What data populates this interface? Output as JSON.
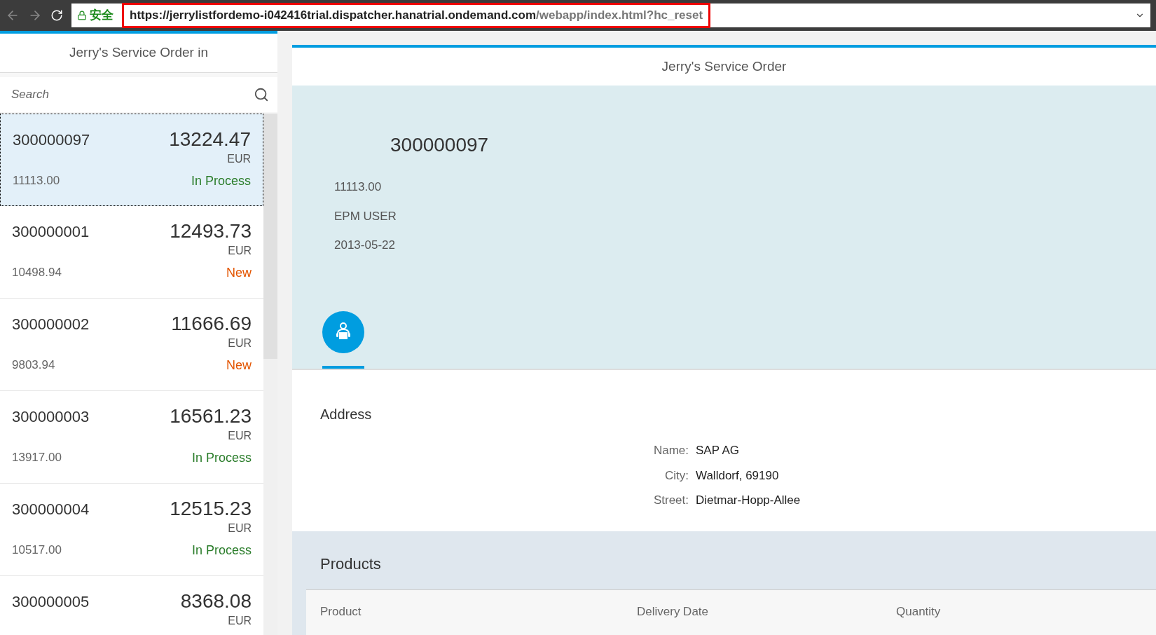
{
  "browser": {
    "security_label": "安全",
    "url_host": "https://jerrylistfordemo-i042416trial.dispatcher.hanatrial.ondemand.com",
    "url_path": "/webapp/index.html?hc_reset"
  },
  "master": {
    "title": "Jerry's Service Order in",
    "search": {
      "placeholder": "Search"
    },
    "items": [
      {
        "number": "300000097",
        "amount": "13224.47",
        "currency": "EUR",
        "attribute": "11113.00",
        "status": "In Process",
        "kind": "success",
        "selected": true
      },
      {
        "number": "300000001",
        "amount": "12493.73",
        "currency": "EUR",
        "attribute": "10498.94",
        "status": "New",
        "kind": "warning",
        "selected": false
      },
      {
        "number": "300000002",
        "amount": "11666.69",
        "currency": "EUR",
        "attribute": "9803.94",
        "status": "New",
        "kind": "warning",
        "selected": false
      },
      {
        "number": "300000003",
        "amount": "16561.23",
        "currency": "EUR",
        "attribute": "13917.00",
        "status": "In Process",
        "kind": "success",
        "selected": false
      },
      {
        "number": "300000004",
        "amount": "12515.23",
        "currency": "EUR",
        "attribute": "10517.00",
        "status": "In Process",
        "kind": "success",
        "selected": false
      },
      {
        "number": "300000005",
        "amount": "8368.08",
        "currency": "EUR",
        "selected": false
      }
    ]
  },
  "detail": {
    "title": "Jerry's Service Order",
    "object_title": "300000097",
    "attributes": [
      "11113.00",
      "EPM USER",
      "2013-05-22"
    ],
    "tabs": [
      {
        "kind": "customer",
        "selected": true
      }
    ],
    "address": {
      "title": "Address",
      "fields": [
        {
          "label": "Name:",
          "value": "SAP AG"
        },
        {
          "label": "City:",
          "value": "Walldorf, 69190"
        },
        {
          "label": "Street:",
          "value": "Dietmar-Hopp-Allee"
        }
      ]
    },
    "products": {
      "title": "Products",
      "columns": [
        "Product",
        "Delivery Date",
        "Quantity"
      ]
    }
  }
}
